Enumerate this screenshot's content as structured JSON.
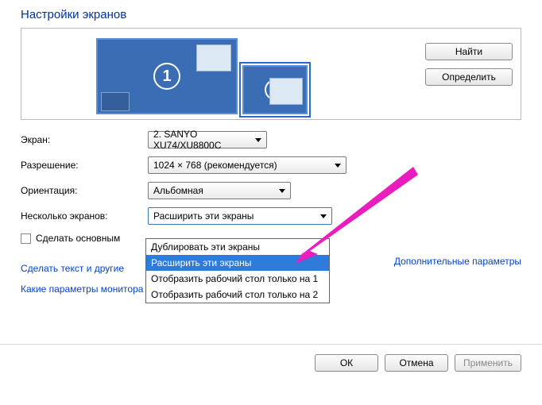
{
  "title": "Настройки экранов",
  "monitors": {
    "m1": "1",
    "m2": "2"
  },
  "buttons": {
    "find": "Найти",
    "detect": "Определить",
    "ok": "ОК",
    "cancel": "Отмена",
    "apply": "Применить"
  },
  "labels": {
    "screen": "Экран:",
    "resolution": "Разрешение:",
    "orientation": "Ориентация:",
    "multiple": "Несколько экранов:",
    "make_main": "Сделать основным"
  },
  "values": {
    "screen": "2. SANYO XU74/XU8800C",
    "resolution": "1024 × 768 (рекомендуется)",
    "orientation": "Альбомная",
    "multiple": "Расширить эти экраны"
  },
  "dropdown_options": [
    "Дублировать эти экраны",
    "Расширить эти экраны",
    "Отобразить рабочий стол только на 1",
    "Отобразить рабочий стол только на 2"
  ],
  "dropdown_selected_index": 1,
  "links": {
    "advanced": "Дополнительные параметры",
    "text_size": "Сделать текст и другие",
    "which_monitor": "Какие параметры монитора следует выбрать?"
  }
}
